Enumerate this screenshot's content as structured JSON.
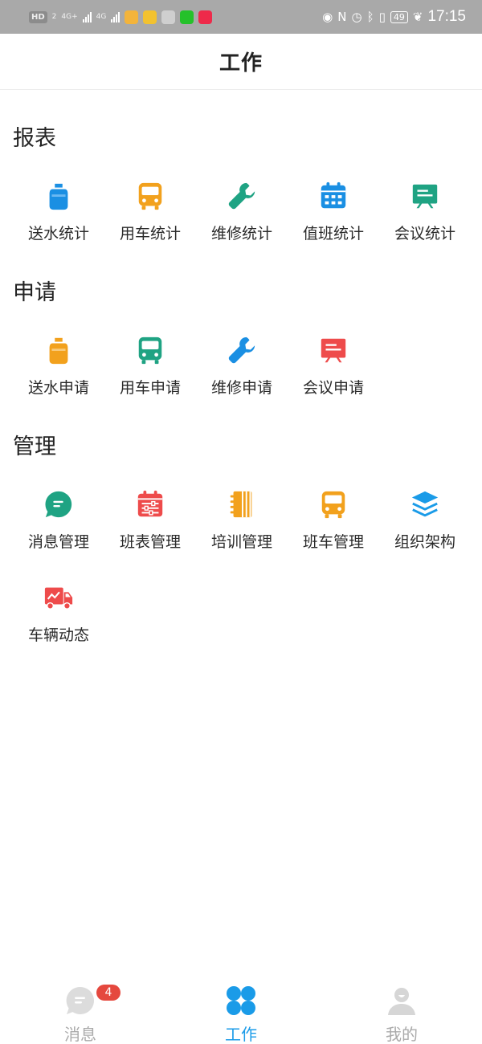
{
  "status_bar": {
    "left_chip": "HD",
    "left_sub": "2",
    "net1": "4G+",
    "net2": "4G",
    "battery": "49",
    "time": "17:15"
  },
  "header": {
    "title": "工作"
  },
  "sections": {
    "reports": {
      "title": "报表",
      "items": [
        {
          "label": "送水统计",
          "icon": "water-bottle-icon",
          "color": "#1a8fe3"
        },
        {
          "label": "用车统计",
          "icon": "bus-icon",
          "color": "#f2a11d"
        },
        {
          "label": "维修统计",
          "icon": "wrench-icon",
          "color": "#1fa383"
        },
        {
          "label": "值班统计",
          "icon": "calendar-icon",
          "color": "#1a8fe3"
        },
        {
          "label": "会议统计",
          "icon": "presentation-board-icon",
          "color": "#1fa383"
        }
      ]
    },
    "apply": {
      "title": "申请",
      "items": [
        {
          "label": "送水申请",
          "icon": "water-bottle-icon",
          "color": "#f2a11d"
        },
        {
          "label": "用车申请",
          "icon": "bus-icon",
          "color": "#1fa383"
        },
        {
          "label": "维修申请",
          "icon": "wrench-icon",
          "color": "#1a8fe3"
        },
        {
          "label": "会议申请",
          "icon": "presentation-board-icon",
          "color": "#ee4b4b"
        }
      ]
    },
    "manage": {
      "title": "管理",
      "items": [
        {
          "label": "消息管理",
          "icon": "chat-bubble-icon",
          "color": "#1fa383"
        },
        {
          "label": "班表管理",
          "icon": "schedule-sliders-icon",
          "color": "#ee4b4b"
        },
        {
          "label": "培训管理",
          "icon": "notebook-icon",
          "color": "#f2a11d"
        },
        {
          "label": "班车管理",
          "icon": "bus-icon",
          "color": "#f2a11d"
        },
        {
          "label": "组织架构",
          "icon": "layers-icon",
          "color": "#1a9be8"
        },
        {
          "label": "车辆动态",
          "icon": "truck-icon",
          "color": "#ee4b4b"
        }
      ]
    }
  },
  "bottom_nav": {
    "messages": {
      "label": "消息",
      "badge": "4",
      "icon": "message-icon"
    },
    "work": {
      "label": "工作",
      "icon": "clover-grid-icon",
      "active_color": "#1a9be8"
    },
    "mine": {
      "label": "我的",
      "icon": "user-icon"
    }
  }
}
